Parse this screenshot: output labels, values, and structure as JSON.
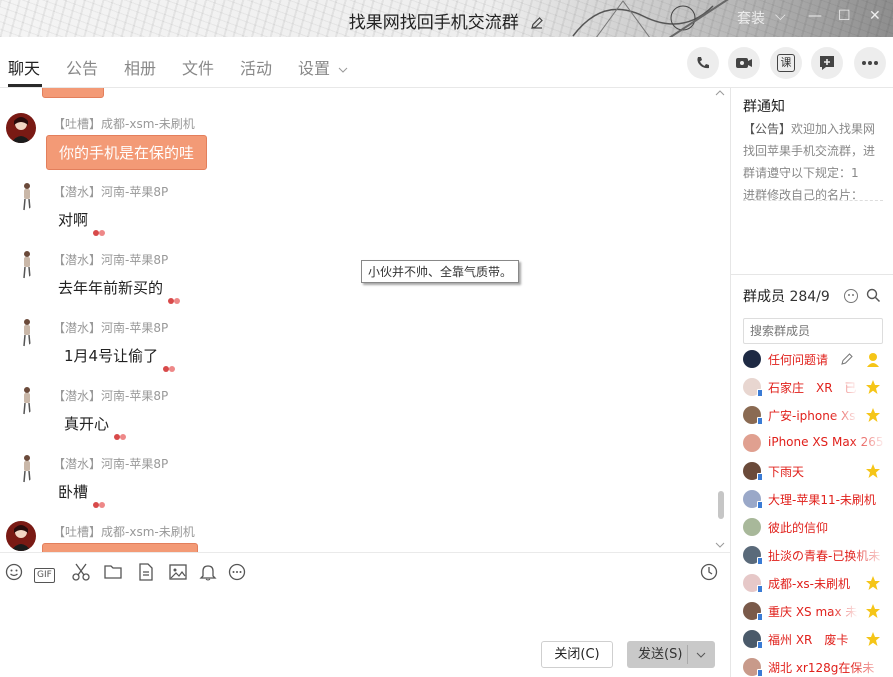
{
  "window": {
    "title": "找果网找回手机交流群",
    "controls": {
      "skin": "套装",
      "dropdown": "⌵",
      "minimize": "—",
      "maximize": "☐",
      "close": "✕"
    }
  },
  "tabs": [
    {
      "label": "聊天",
      "active": true
    },
    {
      "label": "公告",
      "active": false
    },
    {
      "label": "相册",
      "active": false
    },
    {
      "label": "文件",
      "active": false
    },
    {
      "label": "活动",
      "active": false
    },
    {
      "label": "设置",
      "active": false
    }
  ],
  "toolbar_buttons": [
    {
      "icon": "phone-icon"
    },
    {
      "icon": "video-icon"
    },
    {
      "icon": "class-icon",
      "label": "课"
    },
    {
      "icon": "app-plus-icon"
    },
    {
      "icon": "more-icon"
    }
  ],
  "messages": [
    {
      "tag": "【吐槽】",
      "sender": "成都-xsm-未刷机",
      "text": "你的手机是在保的哇",
      "style": "orange"
    },
    {
      "tag": "【潜水】",
      "sender": "河南-苹果8P",
      "text": "对啊",
      "style": "plain"
    },
    {
      "tag": "【潜水】",
      "sender": "河南-苹果8P",
      "text": "去年年前新买的",
      "style": "plain"
    },
    {
      "tag": "【潜水】",
      "sender": "河南-苹果8P",
      "text": "1月4号让偷了",
      "style": "plain"
    },
    {
      "tag": "【潜水】",
      "sender": "河南-苹果8P",
      "text": "真开心",
      "style": "plain"
    },
    {
      "tag": "【潜水】",
      "sender": "河南-苹果8P",
      "text": "卧槽",
      "style": "plain"
    },
    {
      "tag": "【吐槽】",
      "sender": "成都-xsm-未刷机",
      "text": "",
      "style": "orange"
    }
  ],
  "tooltip": "小伙并不帅、全靠气质带。",
  "input_tools": [
    "emoji-icon",
    "gif-icon",
    "scissors-icon",
    "folder-icon",
    "doc-icon",
    "image-icon",
    "bell-icon",
    "more-circle-icon"
  ],
  "input_tool_labels": {
    "gif": "GIF"
  },
  "buttons": {
    "close": "关闭(C)",
    "send": "发送(S)"
  },
  "notice": {
    "title": "群通知",
    "tag": "【公告】",
    "text": "欢迎加入找果网找回苹果手机交流群，进群请遵守以下规定：1",
    "line2": "进群修改自己的名片："
  },
  "members": {
    "title": "群成员",
    "count": "284/9",
    "search_placeholder": "搜索群成员",
    "list": [
      {
        "name": "任何问题请",
        "badge": "owner"
      },
      {
        "name": "石家庄　XR　已",
        "badge": "star"
      },
      {
        "name": "广安-iphone Xs",
        "badge": "star"
      },
      {
        "name": "iPhone XS Max 265",
        "badge": ""
      },
      {
        "name": "下雨天",
        "badge": "star"
      },
      {
        "name": "大理-苹果11-未刷机",
        "badge": ""
      },
      {
        "name": "彼此的信仰",
        "badge": ""
      },
      {
        "name": "扯淡の青春-已换机未",
        "badge": ""
      },
      {
        "name": "成都-xs-未刷机",
        "badge": "star"
      },
      {
        "name": "重庆 XS max 未",
        "badge": "star"
      },
      {
        "name": "福州 XR　废卡",
        "badge": "star"
      },
      {
        "name": "湖北 xr128g在保未",
        "badge": ""
      }
    ]
  },
  "colors": {
    "accent_orange": "#f39a76",
    "member_red": "#e0201b",
    "star_yellow": "#f5c518"
  }
}
